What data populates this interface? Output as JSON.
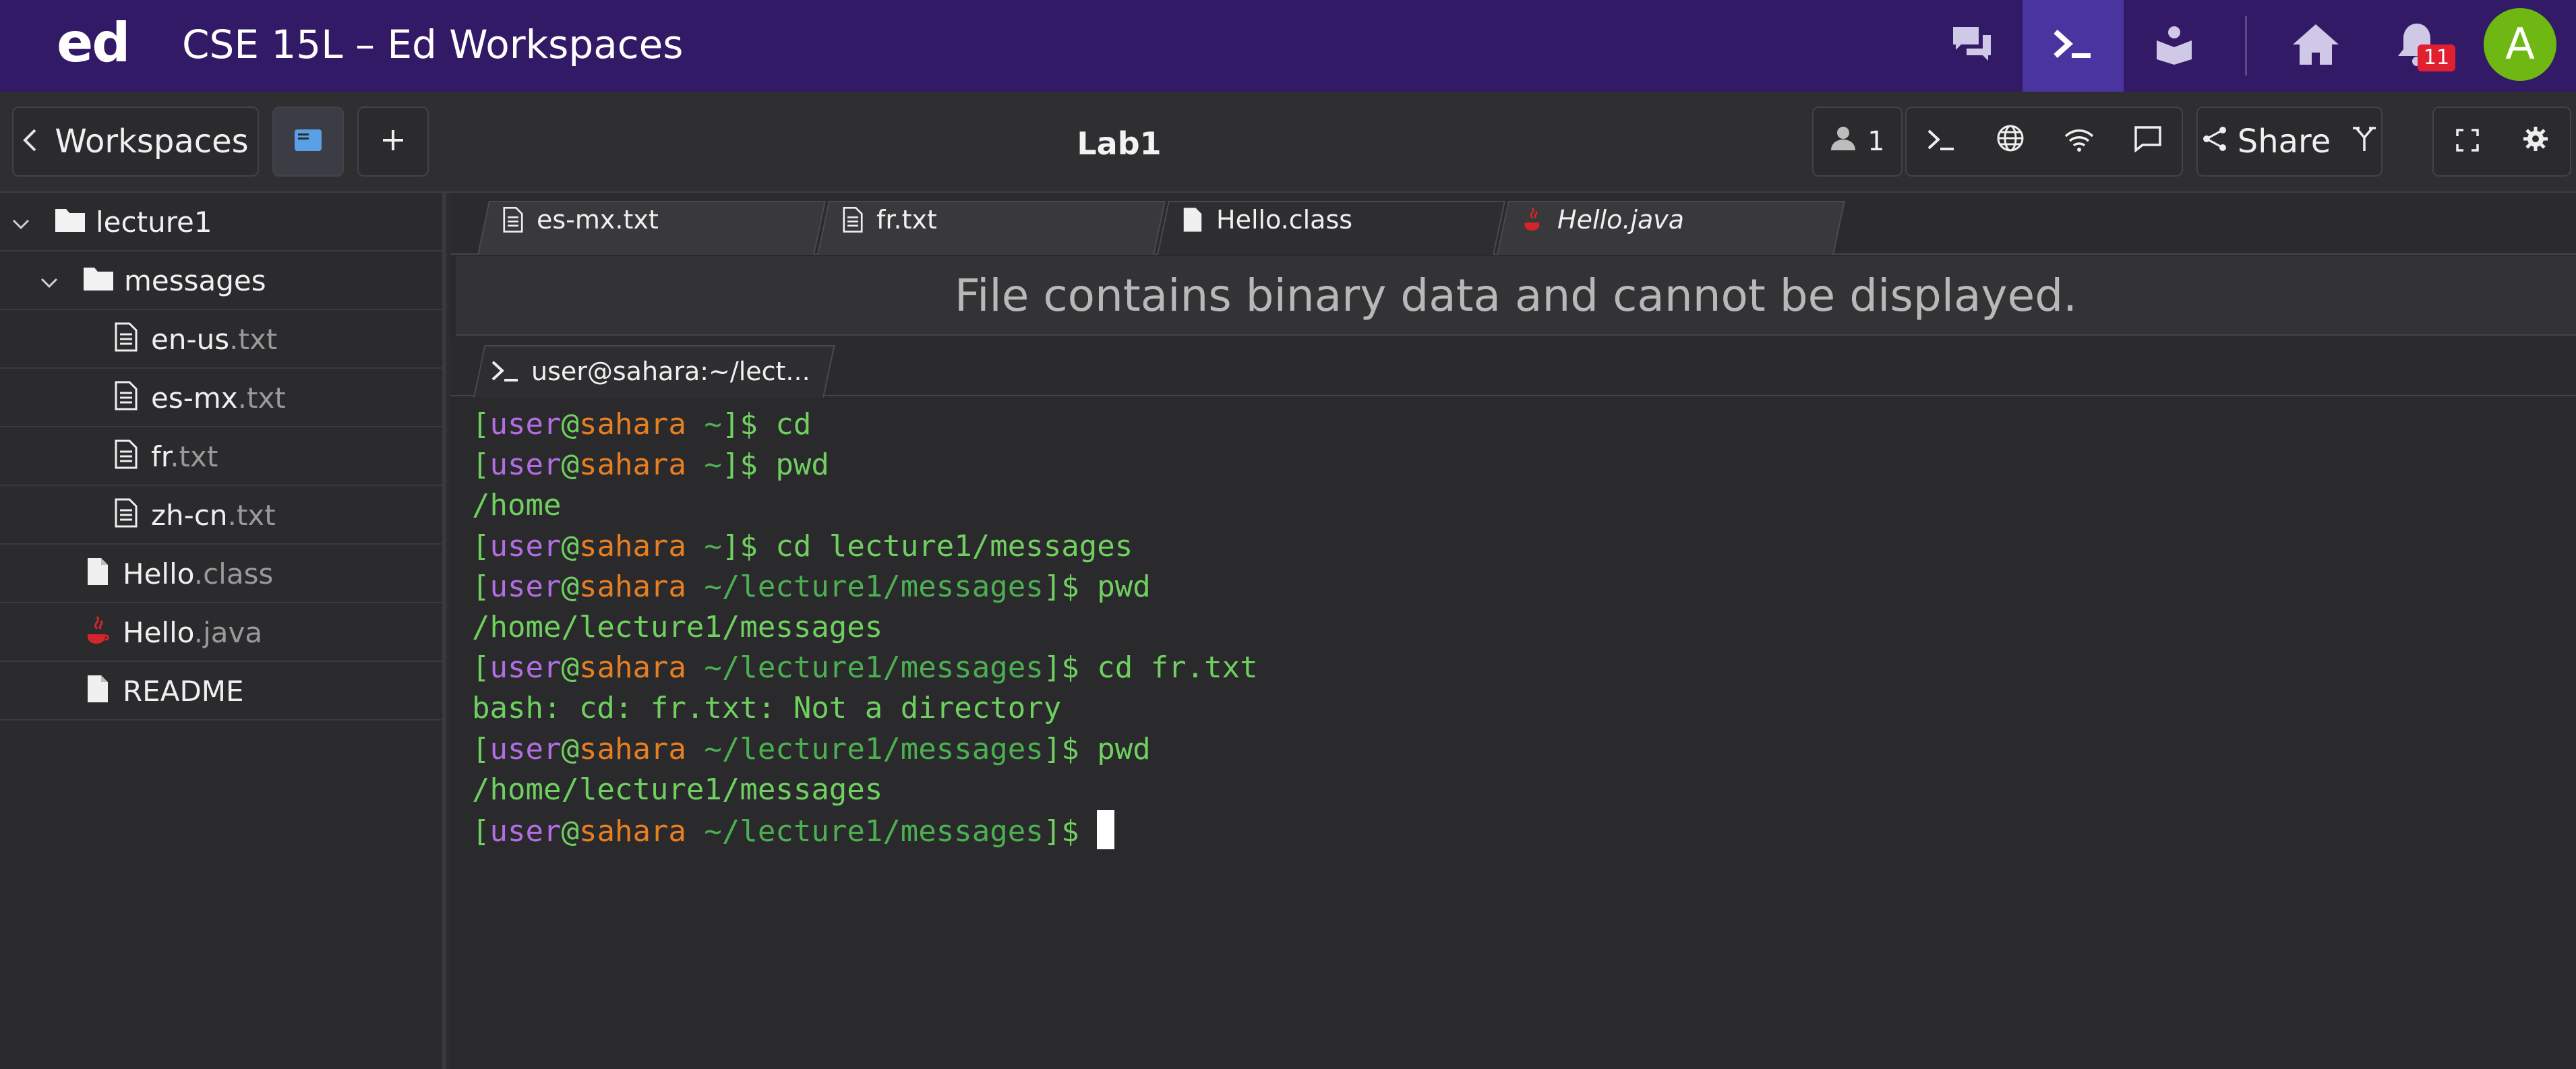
{
  "topbar": {
    "logo": "ed",
    "course_title": "CSE 15L – Ed Workspaces",
    "notification_count": "11",
    "avatar_initial": "A",
    "accent_color": "#331a66",
    "icons": [
      "discussion-icon",
      "terminal-icon",
      "lessons-icon",
      "home-icon",
      "bell-icon"
    ]
  },
  "toolbar": {
    "workspaces_label": "Workspaces",
    "workspace_name": "Lab1",
    "user_count": "1",
    "share_label": "Share"
  },
  "sidebar": {
    "items": [
      {
        "name": "lecture1",
        "ext": "",
        "type": "folder"
      },
      {
        "name": "messages",
        "ext": "",
        "type": "folder"
      },
      {
        "name": "en-us",
        "ext": ".txt",
        "type": "text"
      },
      {
        "name": "es-mx",
        "ext": ".txt",
        "type": "text"
      },
      {
        "name": "fr",
        "ext": ".txt",
        "type": "text"
      },
      {
        "name": "zh-cn",
        "ext": ".txt",
        "type": "text"
      },
      {
        "name": "Hello",
        "ext": ".class",
        "type": "file"
      },
      {
        "name": "Hello",
        "ext": ".java",
        "type": "java"
      },
      {
        "name": "README",
        "ext": "",
        "type": "file"
      }
    ]
  },
  "editor": {
    "tabs": [
      {
        "label": "es-mx.txt"
      },
      {
        "label": "fr.txt"
      },
      {
        "label": "Hello.class"
      },
      {
        "label": "Hello.java"
      }
    ],
    "binary_message": "File contains binary data and cannot be displayed."
  },
  "terminal": {
    "tab_label": "user@sahara:~/lect...",
    "prompt_user": "user",
    "prompt_host": "sahara",
    "lines": [
      {
        "path": "~",
        "cmd": "cd"
      },
      {
        "path": "~",
        "cmd": "pwd"
      },
      {
        "output": "/home"
      },
      {
        "path": "~",
        "cmd": "cd lecture1/messages"
      },
      {
        "path": "~/lecture1/messages",
        "cmd": "pwd"
      },
      {
        "output": "/home/lecture1/messages"
      },
      {
        "path": "~/lecture1/messages",
        "cmd": "cd fr.txt"
      },
      {
        "output": "bash: cd: fr.txt: Not a directory"
      },
      {
        "path": "~/lecture1/messages",
        "cmd": "pwd"
      },
      {
        "output": "/home/lecture1/messages"
      },
      {
        "path": "~/lecture1/messages",
        "cmd": ""
      }
    ]
  }
}
